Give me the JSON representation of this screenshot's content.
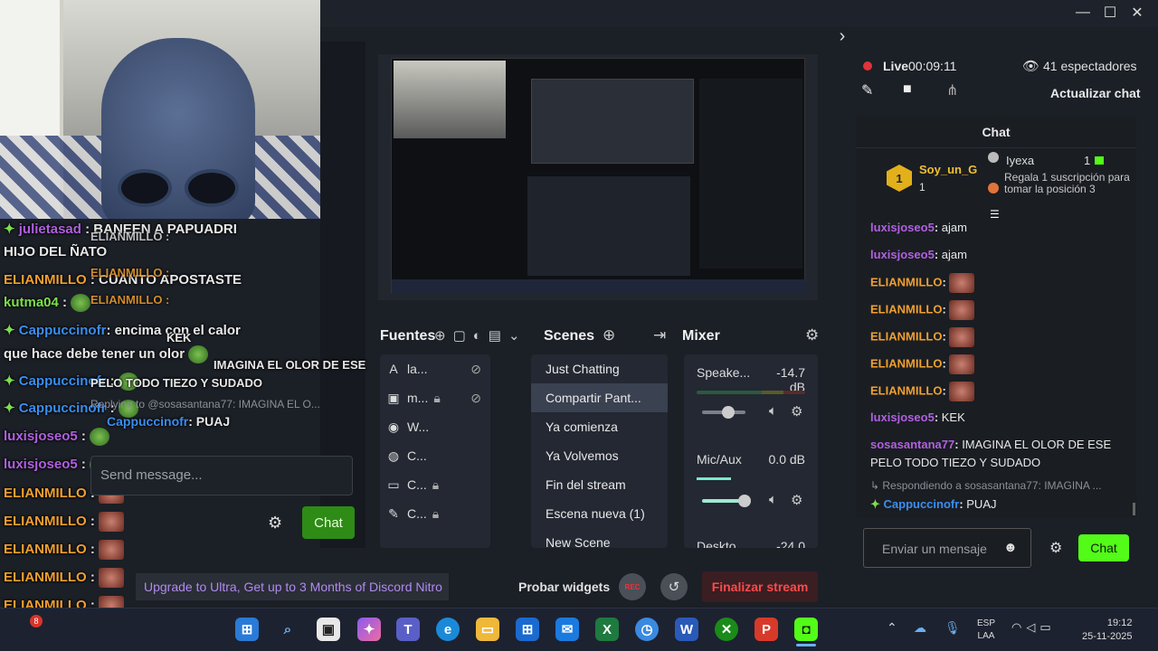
{
  "window": {
    "minimize": "—",
    "maximize": "☐",
    "close": "✕",
    "collapse": "›"
  },
  "stream": {
    "live_label": "Live",
    "time": "00:09:11",
    "viewers": "41 espectadores",
    "update_chat": "Actualizar chat"
  },
  "right_chat": {
    "title": "Chat",
    "pinned": {
      "rank": "1",
      "user": "Soy_un_G",
      "count": "1",
      "gifter": "Iyexa",
      "gift_count": "1",
      "gift_text": "Regala 1 suscripción para tomar la posición 3"
    },
    "messages": [
      {
        "user": "luxisjoseo5",
        "text": "ajam",
        "color": "#b060e0"
      },
      {
        "user": "luxisjoseo5",
        "text": "ajam",
        "color": "#b060e0"
      },
      {
        "user": "ELIANMILLO",
        "text": "",
        "color": "#f0a030"
      },
      {
        "user": "ELIANMILLO",
        "text": "",
        "color": "#f0a030"
      },
      {
        "user": "ELIANMILLO",
        "text": "",
        "color": "#f0a030"
      },
      {
        "user": "ELIANMILLO",
        "text": "",
        "color": "#f0a030"
      },
      {
        "user": "ELIANMILLO",
        "text": "",
        "color": "#f0a030"
      },
      {
        "user": "luxisjoseo5",
        "text": "KEK",
        "color": "#b060e0"
      },
      {
        "user": "sosasantana77",
        "text": "IMAGINA EL OLOR DE ESE PELO TODO TIEZO Y SUDADO",
        "color": "#b060e0"
      }
    ],
    "reply_note": "Respondiendo a sosasantana77: IMAGINA ...",
    "reply_user": "Cappuccinofr",
    "reply_text": "PUAJ",
    "input_placeholder": "Enviar un mensaje",
    "send_label": "Chat"
  },
  "overlay_chat": {
    "lines": [
      {
        "user": "julietasad",
        "text": "BANEEN A PAPUADRI"
      },
      {
        "user": "",
        "text": "HIJO DEL ÑATO"
      },
      {
        "user": "ELIANMILLO",
        "text": "CUANTO APOSTASTE"
      },
      {
        "user": "kutma04",
        "text": ""
      },
      {
        "user": "Cappuccinofr",
        "text": "encima con el calor"
      },
      {
        "user": "",
        "text": "que hace debe tener un olor"
      },
      {
        "user": "Cappuccinofr",
        "text": ""
      },
      {
        "user": "Cappuccinofr",
        "text": ""
      },
      {
        "user": "luxisjoseo5",
        "text": ""
      },
      {
        "user": "luxisjoseo5",
        "text": ""
      },
      {
        "user": "ELIANMILLO",
        "text": ""
      },
      {
        "user": "ELIANMILLO",
        "text": ""
      },
      {
        "user": "ELIANMILLO",
        "text": ""
      },
      {
        "user": "ELIANMILLO",
        "text": ""
      },
      {
        "user": "ELIANMILLO",
        "text": ""
      },
      {
        "user": "luxisjoseo5",
        "text": ""
      }
    ],
    "ghost_lines": [
      "ELIANMILLO :",
      "ELIANMILLO :",
      "ELIANMILLO :",
      "KEK",
      "IMAGINA EL OLOR DE ESE",
      "PELO TODO TIEZO Y SUDADO"
    ],
    "reply_note": "Replying to @sosasantana77: IMAGINA EL O...",
    "reply_user": "Cappuccinofr",
    "reply_text": "PUAJ",
    "input_placeholder": "Send message...",
    "send_label": "Chat"
  },
  "docks": {
    "sources_title": "Fuentes",
    "scenes_title": "Scenes",
    "mixer_title": "Mixer",
    "sources": [
      {
        "icon": "A",
        "label": "la..."
      },
      {
        "icon": "▣",
        "label": "m..."
      },
      {
        "icon": "◉",
        "label": "W..."
      },
      {
        "icon": "◍",
        "label": "C..."
      },
      {
        "icon": "▭",
        "label": "C..."
      },
      {
        "icon": "✎",
        "label": "C..."
      }
    ],
    "scenes": [
      "Just Chatting",
      "Compartir Pant...",
      "Ya comienza",
      "Ya Volvemos",
      "Fin del stream",
      "Escena nueva (1)",
      "New Scene"
    ],
    "selected_scene": 1,
    "mixer": [
      {
        "name": "Speake...",
        "db": "-14.7 dB",
        "level": 0.45
      },
      {
        "name": "Mic/Aux",
        "db": "0.0 dB",
        "level": 0.7
      },
      {
        "name": "Deskto...",
        "db": "-24.0 dB",
        "level": 0.3
      }
    ]
  },
  "bottom": {
    "discord_promo": "Upgrade to Ultra, Get up to 3 Months of Discord Nitro",
    "probar": "Probar widgets",
    "rec": "REC",
    "finalizar": "Finalizar stream"
  },
  "taskbar": {
    "lang": "ESP",
    "lang2": "LAA",
    "time": "19:12",
    "date": "25-11-2025",
    "badge": "8"
  },
  "colors": {
    "accent_green": "#53fc18",
    "live_red": "#e0333a",
    "finalizar_red": "#ff4a4a"
  }
}
